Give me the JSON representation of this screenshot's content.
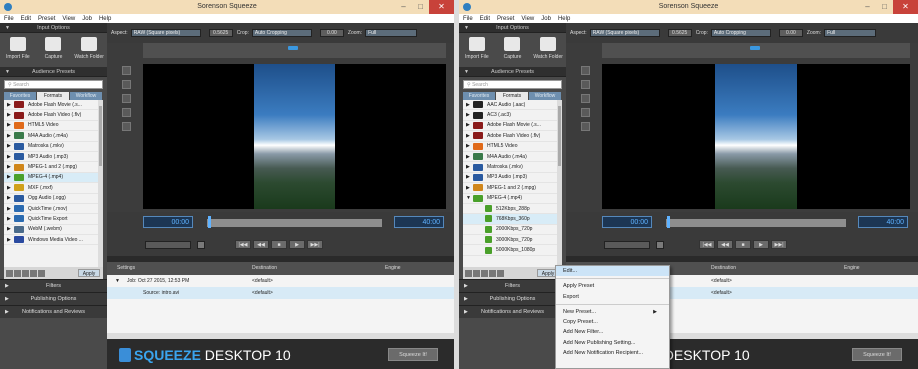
{
  "title": "Sorenson Squeeze",
  "window_controls": [
    "–",
    "□",
    "✕"
  ],
  "menu": [
    "File",
    "Edit",
    "Preset",
    "View",
    "Job",
    "Help"
  ],
  "input_options": "Input Options",
  "import_buttons": [
    "Import File",
    "Capture",
    "Watch Folder"
  ],
  "audience_presets": "Audience Presets",
  "search_placeholder": "Search",
  "tabs": [
    "Favorites",
    "Formats",
    "Workflow"
  ],
  "left_list": [
    {
      "label": "Adobe Flash Movie (.s...",
      "color": "#8a1a1a"
    },
    {
      "label": "Adobe Flash Video (.flv)",
      "color": "#8a1a1a"
    },
    {
      "label": "HTML5 Video",
      "color": "#e06a1a"
    },
    {
      "label": "M4A Audio (.m4a)",
      "color": "#3a7a4a"
    },
    {
      "label": "Matroska (.mkv)",
      "color": "#2a5aa0"
    },
    {
      "label": "MP3 Audio (.mp3)",
      "color": "#2a5aa0"
    },
    {
      "label": "MPEG-1 and 2 (.mpg)",
      "color": "#d0861a"
    },
    {
      "label": "MPEG-4 (.mp4)",
      "color": "#4aa02a"
    },
    {
      "label": "MXF (.mxf)",
      "color": "#d0a01a"
    },
    {
      "label": "Ogg Audio (.ogg)",
      "color": "#2a5aa0"
    },
    {
      "label": "QuickTime (.mov)",
      "color": "#2a6ab0"
    },
    {
      "label": "QuickTime Export",
      "color": "#2a6ab0"
    },
    {
      "label": "WebM (.webm)",
      "color": "#4a6a8a"
    },
    {
      "label": "Windows Media Video ...",
      "color": "#2a4aa0"
    }
  ],
  "right_list": [
    {
      "label": "AAC Audio (.aac)",
      "color": "#222222",
      "sub": false
    },
    {
      "label": "AC3 (.ac3)",
      "color": "#222222",
      "sub": false
    },
    {
      "label": "Adobe Flash Movie (.s...",
      "color": "#8a1a1a",
      "sub": false
    },
    {
      "label": "Adobe Flash Video (.flv)",
      "color": "#8a1a1a",
      "sub": false
    },
    {
      "label": "HTML5 Video",
      "color": "#e06a1a",
      "sub": false
    },
    {
      "label": "M4A Audio (.m4a)",
      "color": "#3a7a4a",
      "sub": false
    },
    {
      "label": "Matroska (.mkv)",
      "color": "#2a5aa0",
      "sub": false
    },
    {
      "label": "MP3 Audio (.mp3)",
      "color": "#2a5aa0",
      "sub": false
    },
    {
      "label": "MPEG-1 and 2 (.mpg)",
      "color": "#d0861a",
      "sub": false
    },
    {
      "label": "MPEG-4 (.mp4)",
      "color": "#4aa02a",
      "sub": false
    },
    {
      "label": "512Kbps_288p",
      "color": "#4aa02a",
      "sub": true
    },
    {
      "label": "768Kbps_360p",
      "color": "#4aa02a",
      "sub": true
    },
    {
      "label": "2000Kbps_720p",
      "color": "#4aa02a",
      "sub": true
    },
    {
      "label": "3000Kbps_720p",
      "color": "#4aa02a",
      "sub": true
    },
    {
      "label": "5000Kbps_1080p",
      "color": "#4aa02a",
      "sub": true
    }
  ],
  "apply": "Apply",
  "filters": "Filters",
  "publishing": "Publishing Options",
  "notifications": "Notifications and Reviews",
  "toolbar": {
    "aspect": "Aspect:",
    "aspect_val": "RAW (Square pixels)",
    "num1": "0.5625",
    "crop": "Crop:",
    "crop_val": "Auto Cropping",
    "num2": "0.00",
    "zoom": "Zoom:",
    "zoom_val": "Full"
  },
  "timecode_start": "00:00",
  "timecode_end": "40:00",
  "play_buttons": [
    "|◀◀",
    "◀◀",
    "■",
    "▶",
    "▶▶|"
  ],
  "table": {
    "settings": "Settings",
    "destination": "Destination",
    "engine": "Engine"
  },
  "job": "Job: Oct 27 2015, 12:53 PM",
  "source": "Source: intro.avi",
  "dest": "<default>",
  "logo": {
    "squeeze": "SQUEEZE",
    "desktop": "DESKTOP 10"
  },
  "squeeze_it": "Squeeze It!",
  "context_menu": [
    "Edit...",
    "Apply Preset",
    "Export",
    "New Preset...",
    "Copy Preset...",
    "Add New Filter...",
    "Add New Publishing Setting...",
    "Add New Notification Recipient..."
  ]
}
